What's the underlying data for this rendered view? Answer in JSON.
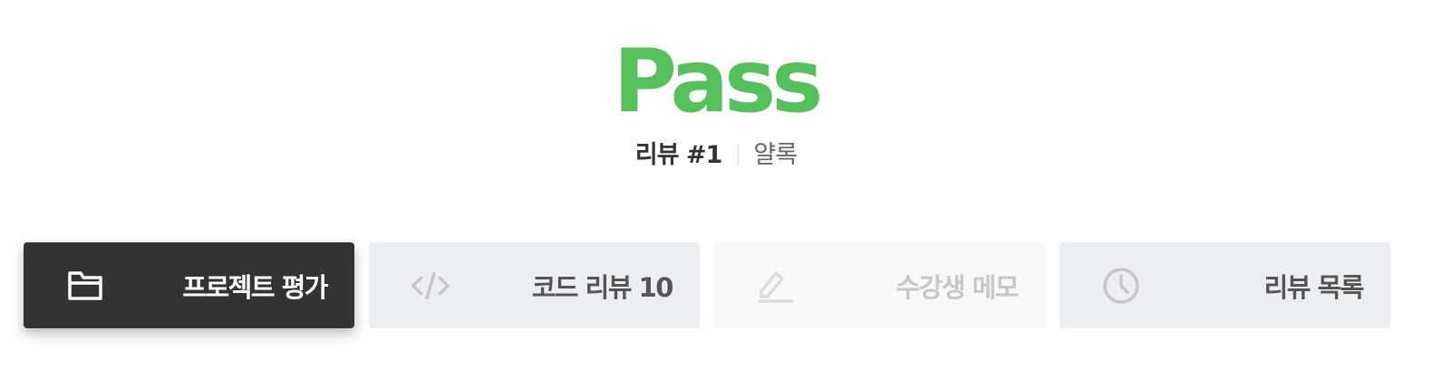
{
  "review": {
    "result": "Pass",
    "number_label": "리뷰 #1",
    "reviewer": "얄록"
  },
  "tabs": [
    {
      "label": "프로젝트 평가",
      "icon": "folder-icon",
      "state": "active"
    },
    {
      "label": "코드 리뷰 10",
      "icon": "code-icon",
      "state": "normal"
    },
    {
      "label": "수강생 메모",
      "icon": "pencil-icon",
      "state": "disabled"
    },
    {
      "label": "리뷰 목록",
      "icon": "clock-icon",
      "state": "normal"
    }
  ],
  "colors": {
    "pass": "#55c15a",
    "active_tab": "#333333",
    "tab": "#eceff1",
    "disabled_tab": "#f7f8f9"
  }
}
